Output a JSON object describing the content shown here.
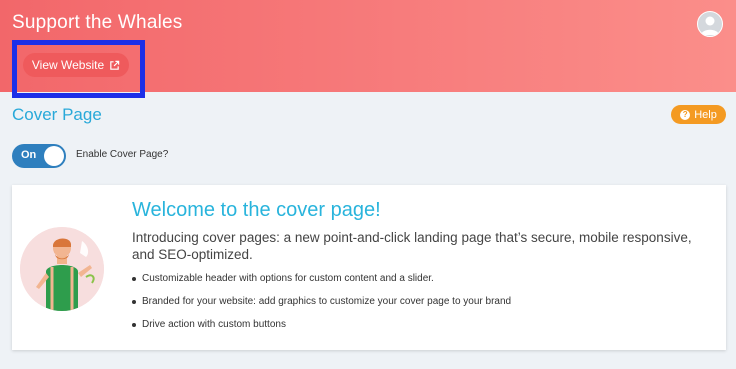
{
  "header": {
    "title": "Support the Whales",
    "view_website_label": "View Website"
  },
  "page": {
    "section_title": "Cover Page",
    "help_label": "Help"
  },
  "toggle": {
    "state_label": "On",
    "label": "Enable Cover Page?"
  },
  "card": {
    "title": "Welcome to the cover page!",
    "intro": "Introducing cover pages: a new point-and-click landing page that’s secure, mobile responsive, and SEO-optimized.",
    "bullets": [
      "Customizable header with options for custom content and a slider.",
      "Branded for your website: add graphics to customize your cover page to your brand",
      "Drive action with custom buttons"
    ]
  },
  "colors": {
    "header_start": "#f2676a",
    "header_end": "#fb8e8a",
    "accent_blue": "#29a9d9",
    "toggle_blue": "#2e7fbe",
    "help_orange": "#f49a22",
    "highlight_box": "#1d2fe8"
  },
  "icons": {
    "external_link": "external-link-icon",
    "help": "question-circle-icon",
    "avatar": "user-avatar-icon"
  }
}
